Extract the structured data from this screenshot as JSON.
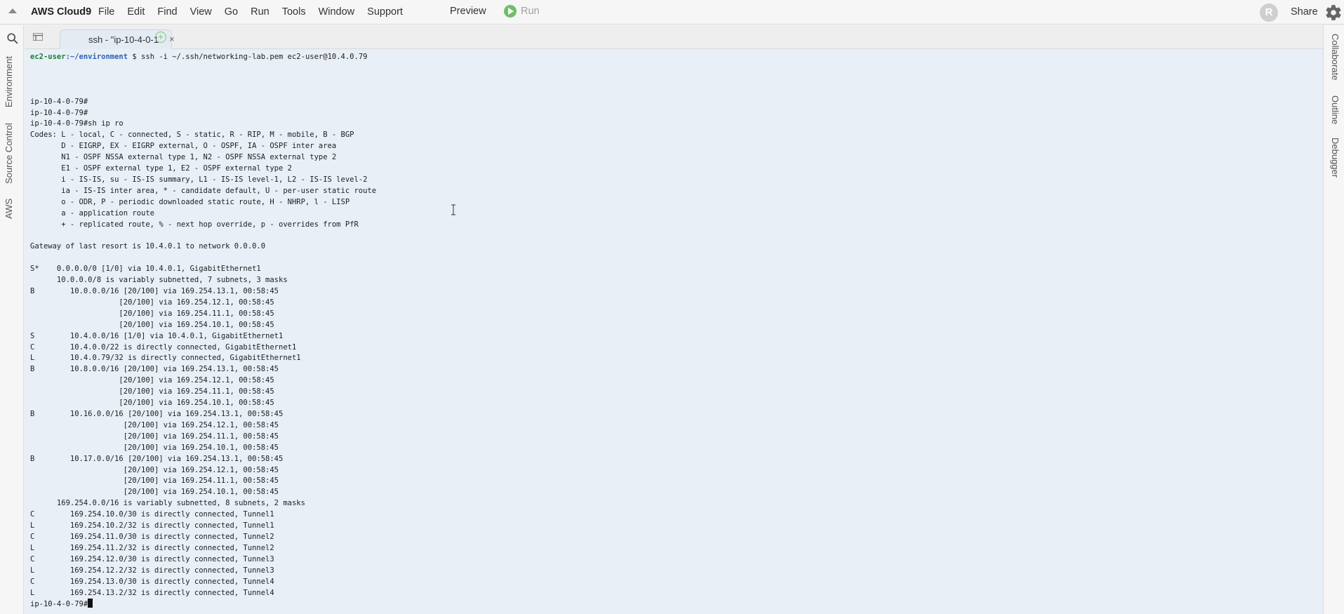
{
  "app": {
    "brand": "AWS Cloud9",
    "menu": [
      "File",
      "Edit",
      "Find",
      "View",
      "Go",
      "Run",
      "Tools",
      "Window",
      "Support"
    ],
    "preview": "Preview",
    "run": "Run",
    "avatar_initial": "R",
    "share": "Share"
  },
  "left_sidebar": [
    "Environment",
    "Source Control",
    "AWS"
  ],
  "right_sidebar": [
    "Collaborate",
    "Outline",
    "Debugger"
  ],
  "tab": {
    "label": "ssh - \"ip-10-4-0-1",
    "close": "×",
    "add": "+"
  },
  "terminal": {
    "prompt_user": "ec2-user",
    "prompt_path": ":~/environment",
    "prompt_cmd": " $ ssh -i ~/.ssh/networking-lab.pem ec2-user@10.4.0.79",
    "final_prompt": "ip-10-4-0-79#",
    "lines": [
      "",
      "",
      "",
      "ip-10-4-0-79#",
      "ip-10-4-0-79#",
      "ip-10-4-0-79#sh ip ro",
      "Codes: L - local, C - connected, S - static, R - RIP, M - mobile, B - BGP",
      "       D - EIGRP, EX - EIGRP external, O - OSPF, IA - OSPF inter area",
      "       N1 - OSPF NSSA external type 1, N2 - OSPF NSSA external type 2",
      "       E1 - OSPF external type 1, E2 - OSPF external type 2",
      "       i - IS-IS, su - IS-IS summary, L1 - IS-IS level-1, L2 - IS-IS level-2",
      "       ia - IS-IS inter area, * - candidate default, U - per-user static route",
      "       o - ODR, P - periodic downloaded static route, H - NHRP, l - LISP",
      "       a - application route",
      "       + - replicated route, % - next hop override, p - overrides from PfR",
      "",
      "Gateway of last resort is 10.4.0.1 to network 0.0.0.0",
      "",
      "S*    0.0.0.0/0 [1/0] via 10.4.0.1, GigabitEthernet1",
      "      10.0.0.0/8 is variably subnetted, 7 subnets, 3 masks",
      "B        10.0.0.0/16 [20/100] via 169.254.13.1, 00:58:45",
      "                    [20/100] via 169.254.12.1, 00:58:45",
      "                    [20/100] via 169.254.11.1, 00:58:45",
      "                    [20/100] via 169.254.10.1, 00:58:45",
      "S        10.4.0.0/16 [1/0] via 10.4.0.1, GigabitEthernet1",
      "C        10.4.0.0/22 is directly connected, GigabitEthernet1",
      "L        10.4.0.79/32 is directly connected, GigabitEthernet1",
      "B        10.8.0.0/16 [20/100] via 169.254.13.1, 00:58:45",
      "                    [20/100] via 169.254.12.1, 00:58:45",
      "                    [20/100] via 169.254.11.1, 00:58:45",
      "                    [20/100] via 169.254.10.1, 00:58:45",
      "B        10.16.0.0/16 [20/100] via 169.254.13.1, 00:58:45",
      "                     [20/100] via 169.254.12.1, 00:58:45",
      "                     [20/100] via 169.254.11.1, 00:58:45",
      "                     [20/100] via 169.254.10.1, 00:58:45",
      "B        10.17.0.0/16 [20/100] via 169.254.13.1, 00:58:45",
      "                     [20/100] via 169.254.12.1, 00:58:45",
      "                     [20/100] via 169.254.11.1, 00:58:45",
      "                     [20/100] via 169.254.10.1, 00:58:45",
      "      169.254.0.0/16 is variably subnetted, 8 subnets, 2 masks",
      "C        169.254.10.0/30 is directly connected, Tunnel1",
      "L        169.254.10.2/32 is directly connected, Tunnel1",
      "C        169.254.11.0/30 is directly connected, Tunnel2",
      "L        169.254.11.2/32 is directly connected, Tunnel2",
      "C        169.254.12.0/30 is directly connected, Tunnel3",
      "L        169.254.12.2/32 is directly connected, Tunnel3",
      "C        169.254.13.0/30 is directly connected, Tunnel4",
      "L        169.254.13.2/32 is directly connected, Tunnel4"
    ]
  },
  "colors": {
    "terminal_bg": "#e8eff7",
    "prompt_user": "#1a7f37",
    "prompt_path": "#2c62b5",
    "run_green": "#6fbf6a"
  }
}
